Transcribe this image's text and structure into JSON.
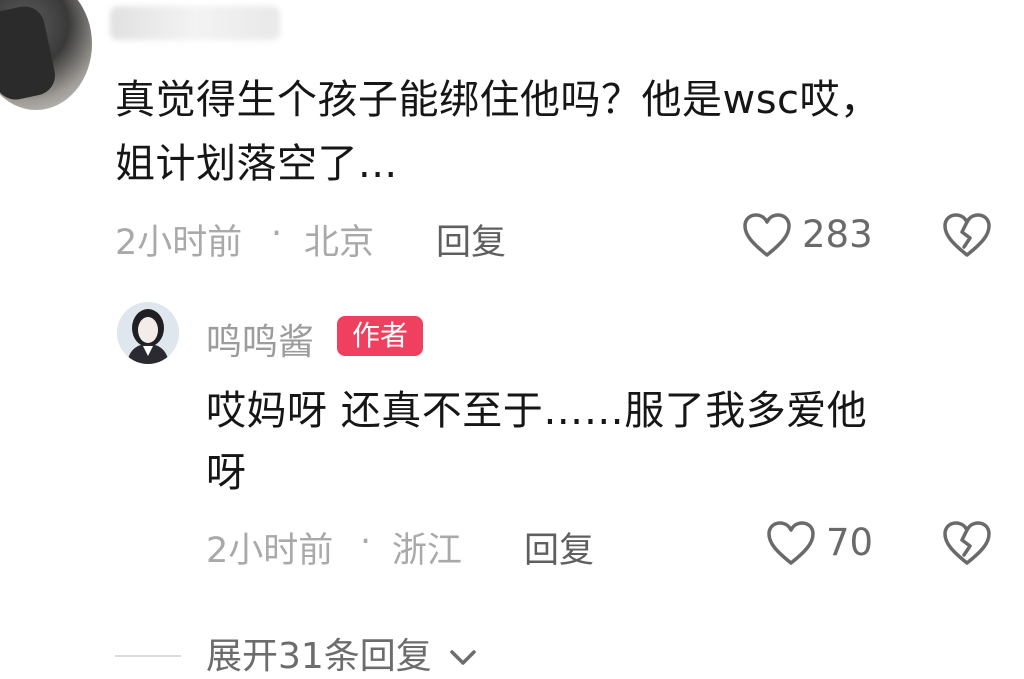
{
  "comments": [
    {
      "text_line1": "真觉得生个孩子能绑住他吗？他是wsc哎，",
      "text_line2": "姐计划落空了...",
      "time": "2小时前",
      "sep": "·",
      "location": "北京",
      "reply_label": "回复",
      "likes": "283"
    }
  ],
  "author_reply": {
    "name": "鸣鸣酱",
    "badge": "作者",
    "text_line1": "哎妈呀 还真不至于……服了我多爱他",
    "text_line2": "呀",
    "time": "2小时前",
    "sep": "·",
    "location": "浙江",
    "reply_label": "回复",
    "likes": "70"
  },
  "expand": {
    "label": "展开31条回复"
  },
  "icons": {
    "like": "heart-outline-icon",
    "dislike": "broken-heart-icon",
    "expand": "chevron-down-icon"
  },
  "colors": {
    "author_badge": "#f0405f",
    "text": "#161616",
    "meta": "#a9a9a9"
  }
}
